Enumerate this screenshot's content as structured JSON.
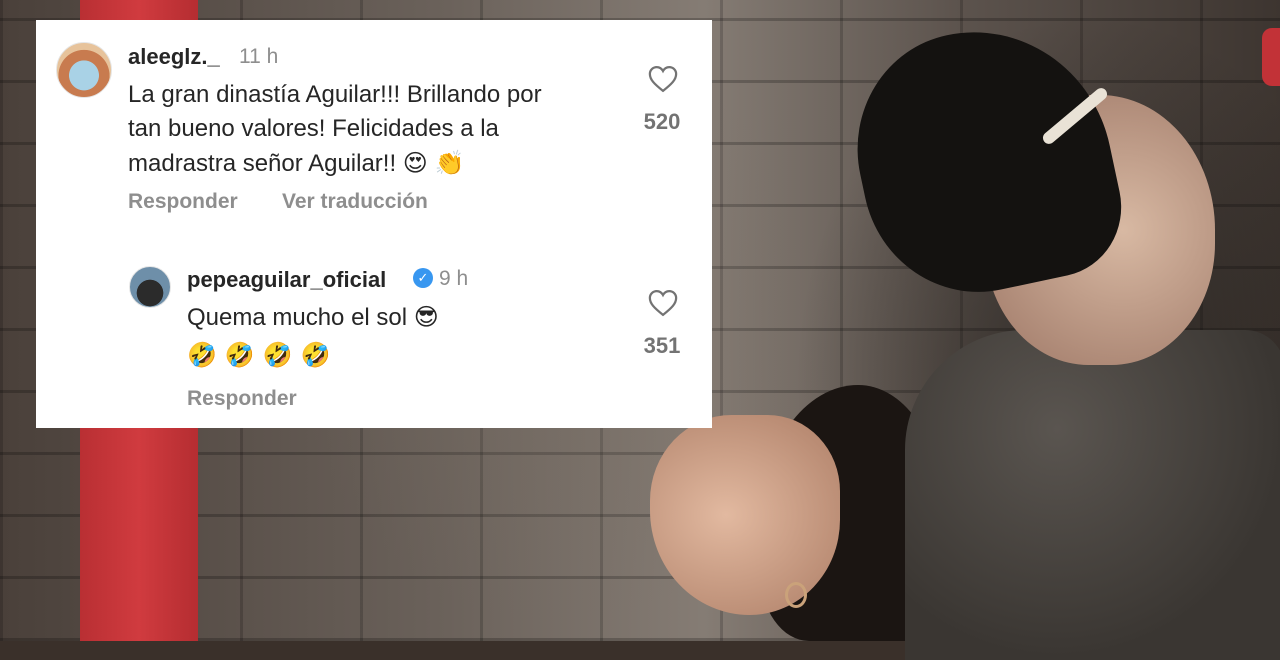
{
  "comments": [
    {
      "username": "aleeglz._",
      "time": "11 h",
      "text_lines": [
        "La gran dinastía Aguilar!!! Brillando por",
        "tan bueno valores! Felicidades a la",
        "madrastra señor Aguilar!!"
      ],
      "emojis": [
        "😍",
        "👏"
      ],
      "likes": "520",
      "actions": [
        "Responder",
        "Ver traducción"
      ]
    }
  ],
  "reply": {
    "username": "pepeaguilar_oficial",
    "verified": true,
    "time": "9 h",
    "text": "Quema mucho el sol",
    "text_emoji": "😎",
    "emoji_row": [
      "🤣",
      "🤣",
      "🤣",
      "🤣"
    ],
    "likes": "351",
    "actions": [
      "Responder"
    ]
  },
  "icons": {
    "like": "heart-outline-icon",
    "verified": "verified-badge-icon"
  },
  "colors": {
    "username": "#262626",
    "meta": "#8e8e8e",
    "verified": "#3897f0",
    "stripe": "#c9373b"
  }
}
